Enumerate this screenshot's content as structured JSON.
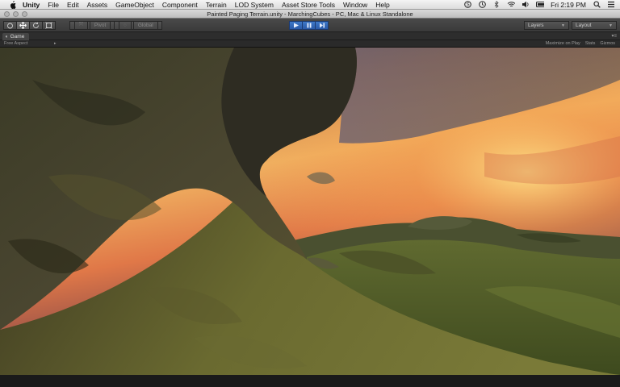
{
  "menubar": {
    "items": [
      "Unity",
      "File",
      "Edit",
      "Assets",
      "GameObject",
      "Component",
      "Terrain",
      "LOD System",
      "Asset Store Tools",
      "Window",
      "Help"
    ],
    "clock": "Fri 2:19 PM",
    "status_icons": [
      "skype-icon",
      "clock-icon",
      "bluetooth-icon",
      "wifi-icon",
      "volume-icon",
      "battery-icon",
      "search-icon",
      "list-icon"
    ]
  },
  "window": {
    "title": "Painted Paging Terrain.unity - MarchingCubes - PC, Mac & Linux Standalone"
  },
  "toolbar": {
    "pivot_label": "Pivot",
    "global_label": "Global",
    "layers_label": "Layers",
    "layout_label": "Layout"
  },
  "game_panel": {
    "tab_label": "Game",
    "aspect_label": "Free Aspect",
    "maximize_label": "Maximize on Play",
    "stats_label": "Stats",
    "gizmos_label": "Gizmos"
  }
}
